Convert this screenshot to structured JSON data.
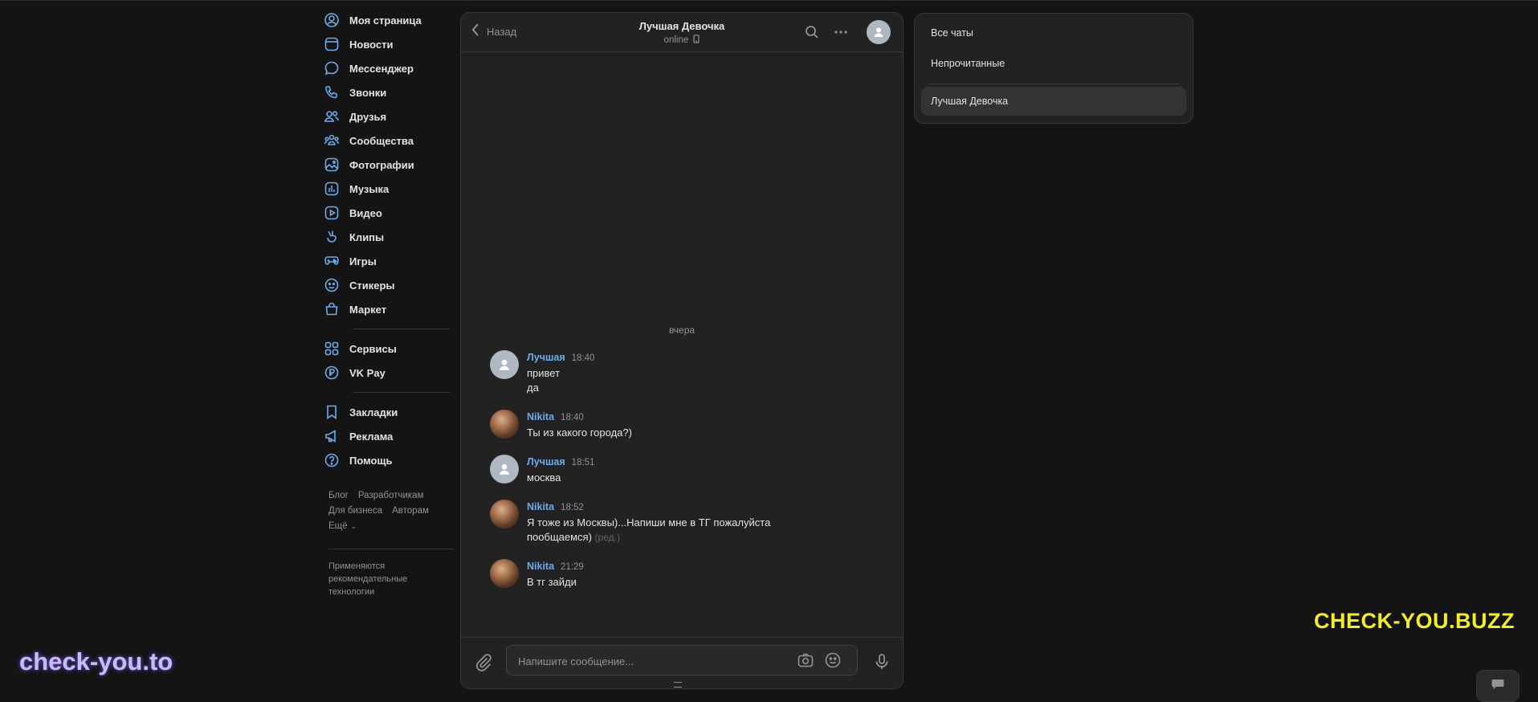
{
  "nav": {
    "items": [
      {
        "label": "Моя страница",
        "icon": "user-circle-icon"
      },
      {
        "label": "Новости",
        "icon": "news-icon"
      },
      {
        "label": "Мессенджер",
        "icon": "message-icon"
      },
      {
        "label": "Звонки",
        "icon": "phone-icon"
      },
      {
        "label": "Друзья",
        "icon": "friends-icon"
      },
      {
        "label": "Сообщества",
        "icon": "communities-icon"
      },
      {
        "label": "Фотографии",
        "icon": "photos-icon"
      },
      {
        "label": "Музыка",
        "icon": "music-icon"
      },
      {
        "label": "Видео",
        "icon": "video-icon"
      },
      {
        "label": "Клипы",
        "icon": "clips-icon"
      },
      {
        "label": "Игры",
        "icon": "gamepad-icon"
      },
      {
        "label": "Стикеры",
        "icon": "sticker-icon"
      },
      {
        "label": "Маркет",
        "icon": "market-bag-icon"
      }
    ],
    "group2": [
      {
        "label": "Сервисы",
        "icon": "services-grid-icon"
      },
      {
        "label": "VK Pay",
        "icon": "vkpay-icon"
      }
    ],
    "group3": [
      {
        "label": "Закладки",
        "icon": "bookmark-icon"
      },
      {
        "label": "Реклама",
        "icon": "megaphone-icon"
      },
      {
        "label": "Помощь",
        "icon": "help-icon"
      }
    ]
  },
  "footer": {
    "links": [
      "Блог",
      "Разработчикам",
      "Для бизнеса",
      "Авторам",
      "Ещё"
    ],
    "note": "Применяются рекомендательные технологии"
  },
  "chat": {
    "back_label": "Назад",
    "title": "Лучшая Девочка",
    "status": "online",
    "date_separator": "вчера",
    "messages": [
      {
        "author": "Лучшая",
        "time": "18:40",
        "lines": [
          "привет",
          "да"
        ],
        "avatar": "default"
      },
      {
        "author": "Nikita",
        "time": "18:40",
        "lines": [
          "Ты из какого города?)"
        ],
        "avatar": "photo"
      },
      {
        "author": "Лучшая",
        "time": "18:51",
        "lines": [
          "москва"
        ],
        "avatar": "default"
      },
      {
        "author": "Nikita",
        "time": "18:52",
        "lines": [
          "Я тоже из Москвы)...Напиши мне в ТГ пожалуйста пообщаемся)"
        ],
        "edited": "(ред.)",
        "avatar": "photo"
      },
      {
        "author": "Nikita",
        "time": "21:29",
        "lines": [
          "В тг зайди"
        ],
        "avatar": "photo"
      }
    ],
    "composer": {
      "placeholder": "Напишите сообщение..."
    }
  },
  "folders": {
    "items": [
      "Все чаты",
      "Непрочитанные",
      "Лучшая Девочка"
    ],
    "active_index": 2
  },
  "watermarks": {
    "right": "CHECK-YOU.BUZZ",
    "left": "check-you.to"
  },
  "colors": {
    "background": "#141414",
    "panel": "#222222",
    "accent_link": "#71aaeb",
    "nav_icon": "#71aaeb",
    "watermark_yellow": "#f4ee2a"
  }
}
